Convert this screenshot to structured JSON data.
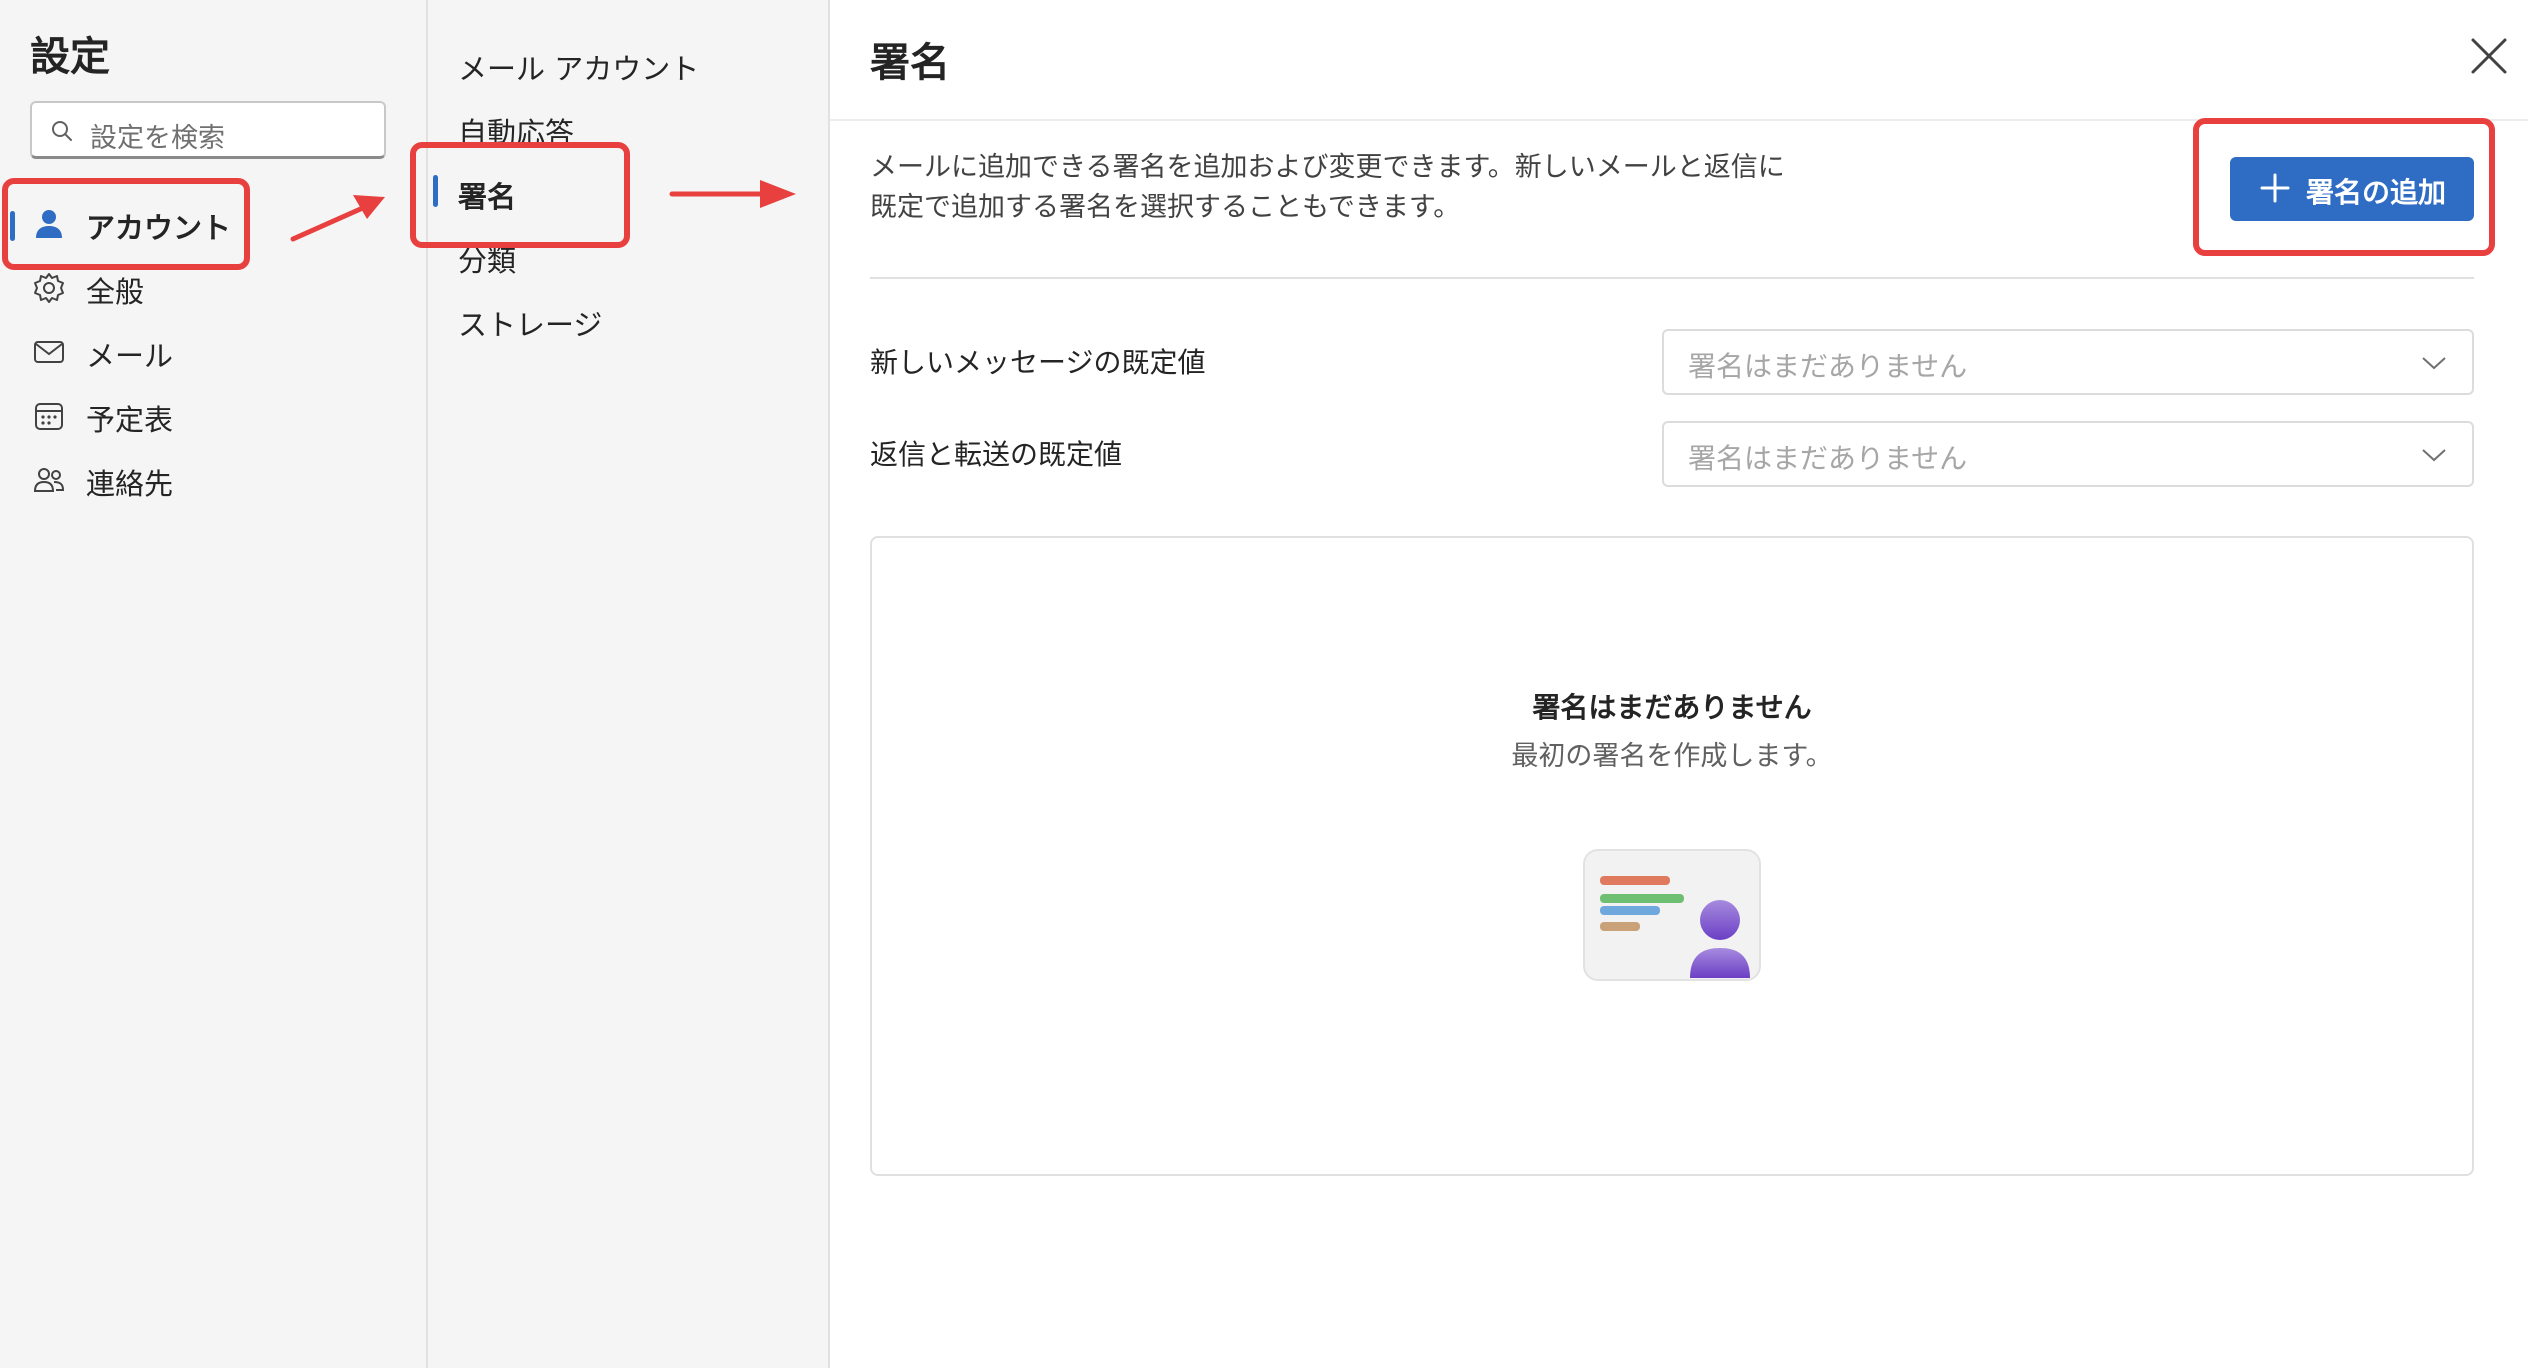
{
  "sidebar": {
    "title": "設定",
    "search_placeholder": "設定を検索",
    "items": [
      {
        "label": "アカウント",
        "icon": "person-icon"
      },
      {
        "label": "全般",
        "icon": "gear-icon"
      },
      {
        "label": "メール",
        "icon": "mail-icon"
      },
      {
        "label": "予定表",
        "icon": "calendar-icon"
      },
      {
        "label": "連絡先",
        "icon": "people-icon"
      }
    ]
  },
  "subnav": {
    "items": [
      {
        "label": "メール アカウント"
      },
      {
        "label": "自動応答"
      },
      {
        "label": "署名"
      },
      {
        "label": "分類"
      },
      {
        "label": "ストレージ"
      }
    ]
  },
  "main": {
    "title": "署名",
    "description": "メールに追加できる署名を追加および変更できます。新しいメールと返信に既定で追加する署名を選択することもできます。",
    "add_button_label": "署名の追加",
    "new_message_label": "新しいメッセージの既定値",
    "new_message_value": "署名はまだありません",
    "reply_label": "返信と転送の既定値",
    "reply_value": "署名はまだありません",
    "empty_title": "署名はまだありません",
    "empty_subtitle": "最初の署名を作成します。"
  },
  "colors": {
    "accent": "#2f6dc4",
    "annotation": "#e8403f"
  }
}
